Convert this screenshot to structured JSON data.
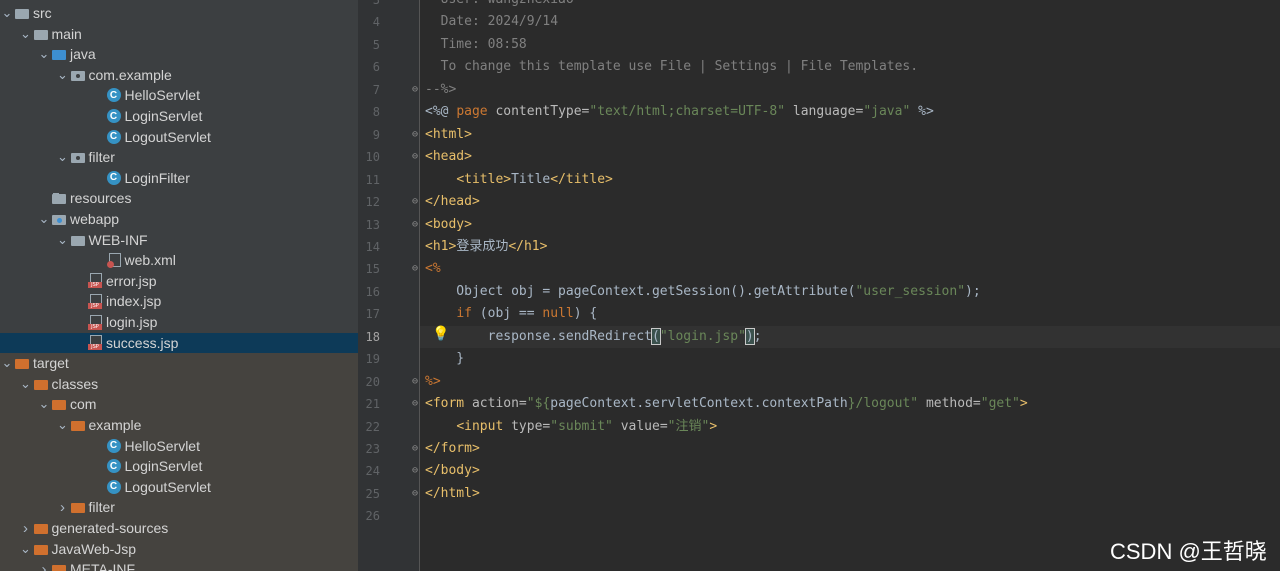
{
  "tree": {
    "rows": [
      {
        "label": "src",
        "icon": "folder-gray",
        "indent": 0,
        "arrow": "down"
      },
      {
        "label": "main",
        "icon": "folder-gray",
        "indent": 1,
        "arrow": "down"
      },
      {
        "label": "java",
        "icon": "folder-blue",
        "indent": 2,
        "arrow": "down"
      },
      {
        "label": "com.example",
        "icon": "folder-pkg",
        "indent": 3,
        "arrow": "down"
      },
      {
        "label": "HelloServlet",
        "icon": "class-c",
        "indent": 5,
        "arrow": ""
      },
      {
        "label": "LoginServlet",
        "icon": "class-c",
        "indent": 5,
        "arrow": ""
      },
      {
        "label": "LogoutServlet",
        "icon": "class-c",
        "indent": 5,
        "arrow": ""
      },
      {
        "label": "filter",
        "icon": "folder-pkg",
        "indent": 3,
        "arrow": "down"
      },
      {
        "label": "LoginFilter",
        "icon": "class-c",
        "indent": 5,
        "arrow": ""
      },
      {
        "label": "resources",
        "icon": "folder-res",
        "indent": 2,
        "arrow": ""
      },
      {
        "label": "webapp",
        "icon": "folder-web",
        "indent": 2,
        "arrow": "down"
      },
      {
        "label": "WEB-INF",
        "icon": "folder-gray",
        "indent": 3,
        "arrow": "down"
      },
      {
        "label": "web.xml",
        "icon": "xml",
        "indent": 5,
        "arrow": ""
      },
      {
        "label": "error.jsp",
        "icon": "jsp",
        "indent": 4,
        "arrow": ""
      },
      {
        "label": "index.jsp",
        "icon": "jsp",
        "indent": 4,
        "arrow": ""
      },
      {
        "label": "login.jsp",
        "icon": "jsp",
        "indent": 4,
        "arrow": ""
      },
      {
        "label": "success.jsp",
        "icon": "jsp",
        "indent": 4,
        "arrow": "",
        "selected": true
      },
      {
        "label": "target",
        "icon": "folder-orange",
        "indent": 0,
        "arrow": "down"
      },
      {
        "label": "classes",
        "icon": "folder-orange",
        "indent": 1,
        "arrow": "down"
      },
      {
        "label": "com",
        "icon": "folder-orange",
        "indent": 2,
        "arrow": "down"
      },
      {
        "label": "example",
        "icon": "folder-orange",
        "indent": 3,
        "arrow": "down"
      },
      {
        "label": "HelloServlet",
        "icon": "class-c",
        "indent": 5,
        "arrow": ""
      },
      {
        "label": "LoginServlet",
        "icon": "class-c",
        "indent": 5,
        "arrow": ""
      },
      {
        "label": "LogoutServlet",
        "icon": "class-c",
        "indent": 5,
        "arrow": ""
      },
      {
        "label": "filter",
        "icon": "folder-orange",
        "indent": 3,
        "arrow": "right"
      },
      {
        "label": "generated-sources",
        "icon": "folder-orange",
        "indent": 1,
        "arrow": "right"
      },
      {
        "label": "JavaWeb-Jsp",
        "icon": "folder-orange",
        "indent": 1,
        "arrow": "down"
      },
      {
        "label": "META-INF",
        "icon": "folder-orange",
        "indent": 2,
        "arrow": "right"
      }
    ]
  },
  "editor": {
    "current_line": 18,
    "lines": [
      {
        "n": "3",
        "parts": [
          {
            "c": "cm",
            "t": "  User: wangzhexiao"
          }
        ]
      },
      {
        "n": "4",
        "parts": [
          {
            "c": "cm",
            "t": "  Date: 2024/9/14"
          }
        ]
      },
      {
        "n": "5",
        "parts": [
          {
            "c": "cm",
            "t": "  Time: 08:58"
          }
        ]
      },
      {
        "n": "6",
        "parts": [
          {
            "c": "cm",
            "t": "  To change this template use File | Settings | File Templates."
          }
        ]
      },
      {
        "n": "7",
        "parts": [
          {
            "c": "cm",
            "t": "--%>"
          }
        ]
      },
      {
        "n": "8",
        "parts": [
          {
            "c": "plain",
            "t": "<%@ "
          },
          {
            "c": "kw",
            "t": "page "
          },
          {
            "c": "attr",
            "t": "contentType="
          },
          {
            "c": "str",
            "t": "\"text/html;charset=UTF-8\""
          },
          {
            "c": "attr",
            "t": " language="
          },
          {
            "c": "str",
            "t": "\"java\""
          },
          {
            "c": "plain",
            "t": " %>"
          }
        ]
      },
      {
        "n": "9",
        "parts": [
          {
            "c": "tag",
            "t": "<html>"
          }
        ]
      },
      {
        "n": "10",
        "parts": [
          {
            "c": "tag",
            "t": "<head>"
          }
        ]
      },
      {
        "n": "11",
        "parts": [
          {
            "c": "plain",
            "t": "    "
          },
          {
            "c": "tag",
            "t": "<title>"
          },
          {
            "c": "plain",
            "t": "Title"
          },
          {
            "c": "tag",
            "t": "</title>"
          }
        ]
      },
      {
        "n": "12",
        "parts": [
          {
            "c": "tag",
            "t": "</head>"
          }
        ]
      },
      {
        "n": "13",
        "parts": [
          {
            "c": "tag",
            "t": "<body>"
          }
        ]
      },
      {
        "n": "14",
        "parts": [
          {
            "c": "tag",
            "t": "<h1>"
          },
          {
            "c": "plain",
            "t": "登录成功"
          },
          {
            "c": "tag",
            "t": "</h1>"
          }
        ]
      },
      {
        "n": "15",
        "parts": [
          {
            "c": "jsp-delim",
            "t": "<%"
          }
        ]
      },
      {
        "n": "16",
        "parts": [
          {
            "c": "plain",
            "t": "    Object obj = pageContext.getSession().getAttribute("
          },
          {
            "c": "str",
            "t": "\"user_session\""
          },
          {
            "c": "plain",
            "t": ");"
          }
        ]
      },
      {
        "n": "17",
        "parts": [
          {
            "c": "plain",
            "t": "    "
          },
          {
            "c": "kw",
            "t": "if"
          },
          {
            "c": "plain",
            "t": " (obj == "
          },
          {
            "c": "kw",
            "t": "null"
          },
          {
            "c": "plain",
            "t": ") {"
          }
        ]
      },
      {
        "n": "18",
        "parts": [
          {
            "c": "plain",
            "t": "        response.sendRedirect"
          },
          {
            "c": "brace-match",
            "t": "("
          },
          {
            "c": "str",
            "t": "\"login.jsp\""
          },
          {
            "c": "brace-match",
            "t": ")"
          },
          {
            "c": "plain",
            "t": ";"
          }
        ]
      },
      {
        "n": "19",
        "parts": [
          {
            "c": "plain",
            "t": "    }"
          }
        ]
      },
      {
        "n": "20",
        "parts": [
          {
            "c": "jsp-delim",
            "t": "%>"
          }
        ]
      },
      {
        "n": "21",
        "parts": [
          {
            "c": "tag",
            "t": "<form "
          },
          {
            "c": "attr",
            "t": "action="
          },
          {
            "c": "str",
            "t": "\"${"
          },
          {
            "c": "plain",
            "t": "pageContext.servletContext.contextPath"
          },
          {
            "c": "str",
            "t": "}/logout\""
          },
          {
            "c": "attr",
            "t": " method="
          },
          {
            "c": "str",
            "t": "\"get\""
          },
          {
            "c": "tag",
            "t": ">"
          }
        ]
      },
      {
        "n": "22",
        "parts": [
          {
            "c": "plain",
            "t": "    "
          },
          {
            "c": "tag",
            "t": "<input "
          },
          {
            "c": "attr",
            "t": "type="
          },
          {
            "c": "str",
            "t": "\"submit\""
          },
          {
            "c": "attr",
            "t": " value="
          },
          {
            "c": "str",
            "t": "\"注销\""
          },
          {
            "c": "tag",
            "t": ">"
          }
        ]
      },
      {
        "n": "23",
        "parts": [
          {
            "c": "tag",
            "t": "</form>"
          }
        ]
      },
      {
        "n": "24",
        "parts": [
          {
            "c": "tag",
            "t": "</body>"
          }
        ]
      },
      {
        "n": "25",
        "parts": [
          {
            "c": "tag",
            "t": "</html>"
          }
        ]
      },
      {
        "n": "26",
        "parts": []
      }
    ],
    "fold_lines": [
      "7",
      "9",
      "10",
      "12",
      "13",
      "15",
      "20",
      "21",
      "23",
      "24",
      "25"
    ]
  },
  "watermark": "CSDN @王哲晓"
}
